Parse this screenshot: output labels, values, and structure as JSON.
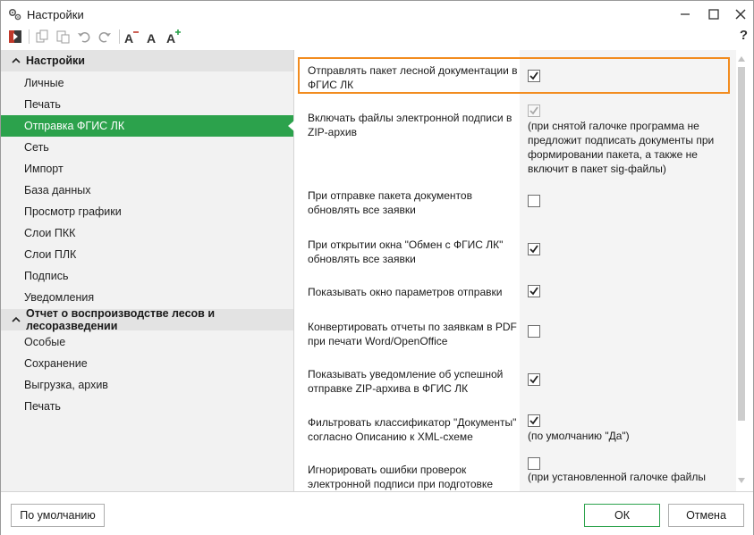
{
  "window": {
    "title": "Настройки"
  },
  "toolbar": {
    "buttons": [
      "exit-icon",
      "copy-icon",
      "paste-icon",
      "undo-icon",
      "redo-icon",
      "font-decrease-icon",
      "font-reset-icon",
      "font-increase-icon"
    ],
    "font_glyph": "A",
    "help_label": "?"
  },
  "sidebar": {
    "groups": [
      {
        "title": "Настройки",
        "items": [
          "Личные",
          "Печать",
          "Отправка ФГИС ЛК",
          "Сеть",
          "Импорт",
          "База данных",
          "Просмотр графики",
          "Слои ПКК",
          "Слои ПЛК",
          "Подпись",
          "Уведомления"
        ]
      },
      {
        "title": "Отчет о воспроизводстве лесов и лесоразведении",
        "items": [
          "Особые",
          "Сохранение",
          "Выгрузка, архив",
          "Печать"
        ]
      }
    ],
    "active_item": "Отправка ФГИС ЛК",
    "accent_color": "#2ca24c"
  },
  "options": [
    {
      "label": "Отправлять пакет лесной документации в ФГИС ЛК",
      "checked": true,
      "disabled": false,
      "note": ""
    },
    {
      "label": "Включать файлы электронной подписи в ZIP-архив",
      "checked": true,
      "disabled": true,
      "note": "(при снятой галочке программа не предложит подписать документы при формировании пакета, а также не включит в пакет sig-файлы)"
    },
    {
      "label": "При отправке пакета документов обновлять все заявки",
      "checked": false,
      "disabled": false,
      "note": ""
    },
    {
      "label": "При открытии окна \"Обмен с ФГИС ЛК\" обновлять все заявки",
      "checked": true,
      "disabled": false,
      "note": ""
    },
    {
      "label": "Показывать окно параметров отправки",
      "checked": true,
      "disabled": false,
      "note": ""
    },
    {
      "label": "Конвертировать отчеты по заявкам в PDF при печати Word/OpenOffice",
      "checked": false,
      "disabled": false,
      "note": ""
    },
    {
      "label": "Показывать уведомление об успешной отправке ZIP-архива в ФГИС ЛК",
      "checked": true,
      "disabled": false,
      "note": ""
    },
    {
      "label": "Фильтровать классификатор \"Документы\" согласно Описанию к XML-схеме",
      "checked": true,
      "disabled": false,
      "note": "(по умолчанию \"Да\")"
    },
    {
      "label": "Игнорировать ошибки проверок электронной подписи при подготовке",
      "checked": false,
      "disabled": false,
      "note": "(при установленной галочке файлы"
    }
  ],
  "highlight_color": "#f28c1f",
  "footer": {
    "default_button": "По умолчанию",
    "ok_button": "ОК",
    "cancel_button": "Отмена"
  }
}
